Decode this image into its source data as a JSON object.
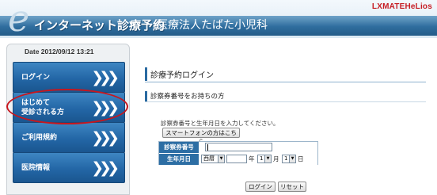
{
  "header": {
    "logo_letter": "e",
    "app_title": "インターネット診療予約",
    "clinic_name": "医療法人たばた小児科",
    "brand": "LXMATEHeLios"
  },
  "sidebar": {
    "date": "Date 2012/09/12 13:21",
    "items": [
      {
        "label": "ログイン"
      },
      {
        "label": "はじめて\n受診される方"
      },
      {
        "label": "ご利用規約"
      },
      {
        "label": "医院情報"
      }
    ],
    "chevron": "❯❯❯"
  },
  "main": {
    "page_title": "診療予約ログイン",
    "section_title": "診察券番号をお持ちの方",
    "instruction": "診察券番号と生年月日を入力してください。",
    "smartphone_button": "スマートフォンの方はこちら",
    "form": {
      "ticket_label": "診察券番号",
      "ticket_value": "",
      "birth_label": "生年月日",
      "era_value": "西暦",
      "year_value": "",
      "year_unit": "年",
      "month_value": "1",
      "month_unit": "月",
      "day_value": "1",
      "day_unit": "日"
    },
    "login_button": "ログイン",
    "reset_button": "リセット"
  },
  "colors": {
    "header_band": "#2f6d9e",
    "menu_blue": "#2366a6",
    "highlight_red": "#c8161d",
    "brand_red": "#c61d23"
  }
}
